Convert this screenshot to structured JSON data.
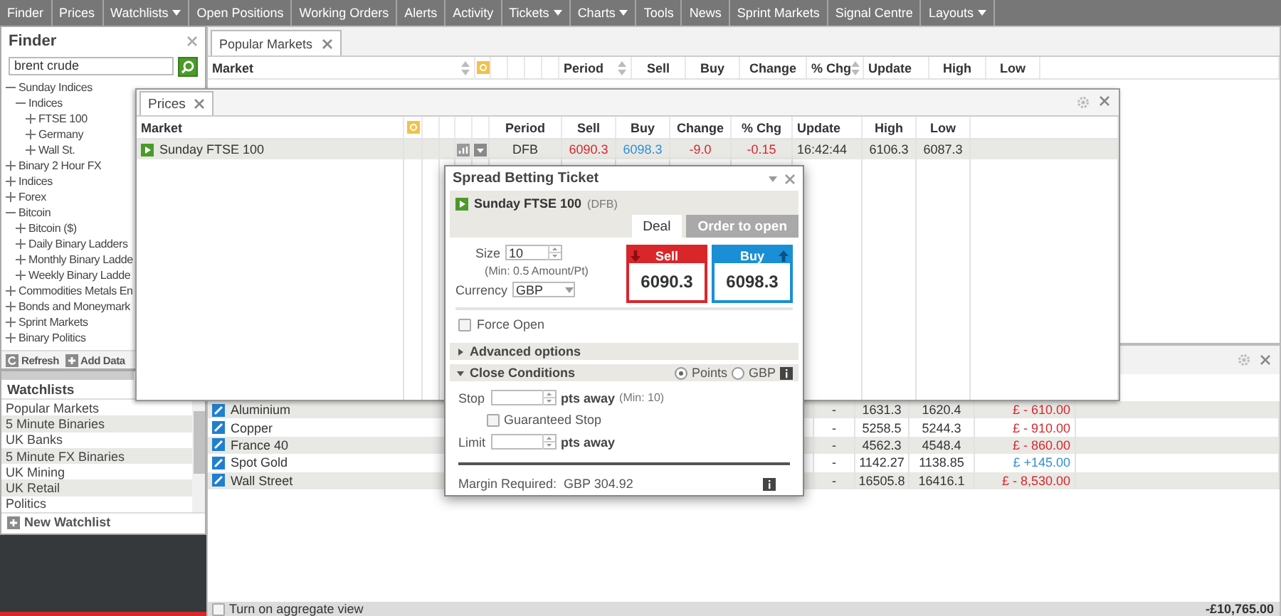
{
  "menu": [
    {
      "label": "Finder",
      "has_menu": false
    },
    {
      "label": "Prices",
      "has_menu": false
    },
    {
      "label": "Watchlists",
      "has_menu": true
    },
    {
      "label": "Open Positions",
      "has_menu": false
    },
    {
      "label": "Working Orders",
      "has_menu": false
    },
    {
      "label": "Alerts",
      "has_menu": false
    },
    {
      "label": "Activity",
      "has_menu": false
    },
    {
      "label": "Tickets",
      "has_menu": true
    },
    {
      "label": "Charts",
      "has_menu": true
    },
    {
      "label": "Tools",
      "has_menu": false
    },
    {
      "label": "News",
      "has_menu": false
    },
    {
      "label": "Sprint Markets",
      "has_menu": false
    },
    {
      "label": "Signal Centre",
      "has_menu": false
    },
    {
      "label": "Layouts",
      "has_menu": true
    }
  ],
  "finder": {
    "title": "Finder",
    "search": {
      "value": "brent crude"
    },
    "tree": [
      {
        "label": "Sunday Indices",
        "expanded": true,
        "children": [
          {
            "label": "Indices",
            "expanded": true,
            "children": [
              {
                "label": "FTSE 100",
                "expanded": false
              },
              {
                "label": "Germany",
                "expanded": false
              },
              {
                "label": "Wall St.",
                "expanded": false
              }
            ]
          }
        ]
      },
      {
        "label": "Binary 2 Hour FX",
        "expanded": false
      },
      {
        "label": "Indices",
        "expanded": false
      },
      {
        "label": "Forex",
        "expanded": false
      },
      {
        "label": "Bitcoin",
        "expanded": true,
        "children": [
          {
            "label": "Bitcoin ($)",
            "expanded": false
          },
          {
            "label": "Daily Binary Ladders",
            "expanded": false
          },
          {
            "label": "Monthly Binary Ladde",
            "expanded": false
          },
          {
            "label": "Weekly Binary Ladde",
            "expanded": false
          }
        ]
      },
      {
        "label": "Commodities Metals En",
        "expanded": false
      },
      {
        "label": "Bonds and Moneymark",
        "expanded": false
      },
      {
        "label": "Sprint Markets",
        "expanded": false
      },
      {
        "label": "Binary Politics",
        "expanded": false
      }
    ],
    "buttons": [
      {
        "label": "Refresh",
        "kind": "refresh"
      },
      {
        "label": "Add Data",
        "kind": "add"
      }
    ]
  },
  "watchlists": {
    "title": "Watchlists",
    "items": [
      "Popular Markets",
      "5 Minute Binaries",
      "UK Banks",
      "5 Minute FX Binaries",
      "UK Mining",
      "UK Retail",
      "Politics"
    ],
    "button": "New Watchlist"
  },
  "popular_markets": {
    "tab": "Popular Markets",
    "columns": [
      "Market",
      "Period",
      "Sell",
      "Buy",
      "Change",
      "% Chg",
      "Update",
      "High",
      "Low"
    ]
  },
  "prices_window": {
    "tab": "Prices",
    "columns": [
      "Market",
      "Period",
      "Sell",
      "Buy",
      "Change",
      "% Chg",
      "Update",
      "High",
      "Low"
    ],
    "rows": [
      {
        "market": "Sunday FTSE 100",
        "period": "DFB",
        "sell": "6090.3",
        "buy": "6098.3",
        "change": "-9.0",
        "pct_change": "-0.15",
        "update": "16:42:44",
        "high": "6106.3",
        "low": "6087.3",
        "color": "#d9262b"
      }
    ]
  },
  "positions": {
    "rows": [
      {
        "market": "Aluminium",
        "values": [
          "-",
          "1631.3",
          "1620.4",
          "£ - 610.00"
        ],
        "color": "#d9262b"
      },
      {
        "market": "Copper",
        "values": [
          "-",
          "5258.5",
          "5244.3",
          "£ - 910.00"
        ],
        "color": "#d9262b"
      },
      {
        "market": "France 40",
        "values": [
          "-",
          "4562.3",
          "4548.4",
          "£ - 860.00"
        ],
        "color": "#d9262b"
      },
      {
        "market": "Spot Gold",
        "values": [
          "-",
          "1142.27",
          "1138.85",
          "£ +145.00"
        ],
        "color": "#2f8fd5"
      },
      {
        "market": "Wall Street",
        "values": [
          "-",
          "16505.8",
          "16416.1",
          "£ - 8,530.00"
        ],
        "color": "#d9262b"
      }
    ],
    "aggregate": {
      "label": "Turn on aggregate view",
      "checked": false
    },
    "total": "-£10,765.00"
  },
  "ticket": {
    "title": "Spread Betting Ticket",
    "market": "Sunday FTSE 100",
    "period": "(DFB)",
    "tabs": [
      {
        "label": "Deal",
        "selected": true
      },
      {
        "label": "Order to open",
        "selected": false
      }
    ],
    "size": {
      "label": "Size",
      "value": "10"
    },
    "min_note": "(Min: 0.5 Amount/Pt)",
    "currency": {
      "label": "Currency",
      "value": "GBP"
    },
    "sell": {
      "label": "Sell",
      "price": "6090.3"
    },
    "buy": {
      "label": "Buy",
      "price": "6098.3"
    },
    "force_open": {
      "label": "Force Open",
      "checked": false
    },
    "sections": [
      {
        "label": "Advanced options",
        "kind": "advanced",
        "expanded": false
      },
      {
        "label": "Close Conditions",
        "kind": "close",
        "expanded": true
      }
    ],
    "units": [
      {
        "label": "Points",
        "selected": true
      },
      {
        "label": "GBP",
        "selected": false
      }
    ],
    "stop": {
      "label": "Stop",
      "unit": "pts away",
      "note": "(Min: 10)"
    },
    "guaranteed_stop": {
      "label": "Guaranteed Stop",
      "checked": false
    },
    "limit": {
      "label": "Limit",
      "unit": "pts away"
    },
    "margin": {
      "label": "Margin Required:",
      "value": "GBP 304.92"
    }
  }
}
